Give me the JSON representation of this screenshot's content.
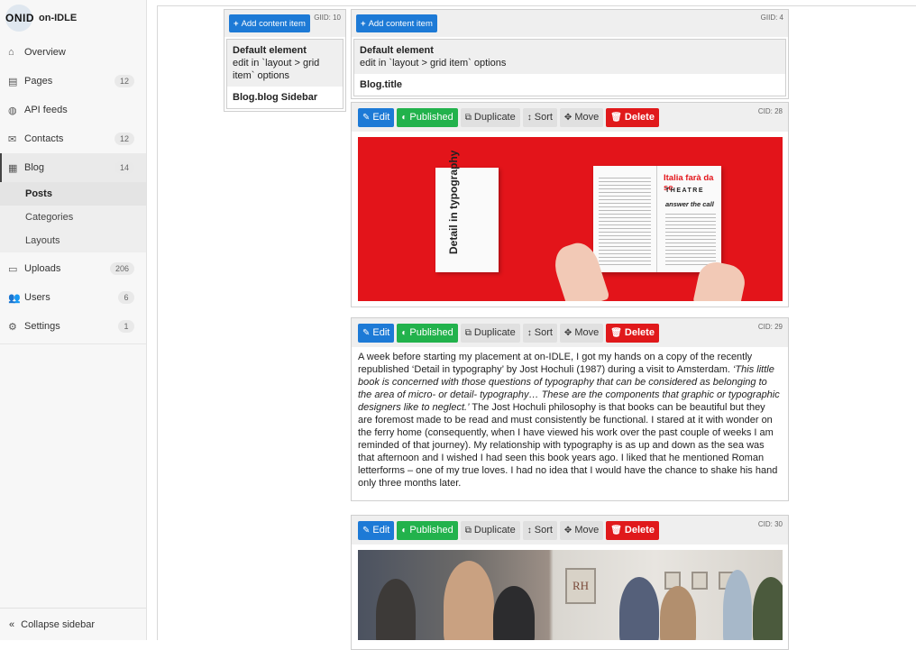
{
  "brand": {
    "logo_text": "ONID",
    "name": "on-IDLE"
  },
  "nav": {
    "overview": "Overview",
    "pages": "Pages",
    "pages_count": "12",
    "api": "API feeds",
    "contacts": "Contacts",
    "contacts_count": "12",
    "blog": "Blog",
    "blog_count": "14",
    "posts": "Posts",
    "categories": "Categories",
    "layouts": "Layouts",
    "uploads": "Uploads",
    "uploads_count": "206",
    "users": "Users",
    "users_count": "6",
    "settings": "Settings",
    "settings_count": "1",
    "collapse": "Collapse sidebar"
  },
  "left_column": {
    "add_label": "Add content item",
    "gid": "GIID: 10",
    "default_title": "Default element",
    "default_desc": "edit in `layout > grid item` options",
    "item_label": "Blog.blog Sidebar"
  },
  "right_column": {
    "add_label": "Add content item",
    "gid": "GIID: 4",
    "default_title": "Default element",
    "default_desc": "edit in `layout > grid item` options",
    "item_label": "Blog.title"
  },
  "toolbar": {
    "edit": "Edit",
    "published": "Published",
    "duplicate": "Duplicate",
    "sort": "Sort",
    "move": "Move",
    "delete": "Delete"
  },
  "cards": {
    "c1": {
      "cid": "CID: 28"
    },
    "c2": {
      "cid": "CID: 29",
      "p1": "A week before starting my placement at on-IDLE, I got my hands on a copy of the recently republished ‘Detail in typography’ by Jost Hochuli (1987) during a visit to Amsterdam. ",
      "quote": "‘This little book is concerned with those questions of typography that can be considered as belonging to the area of micro- or detail- typography… These are the components that graphic or typographic designers like to neglect.’",
      "p2": " The Jost Hochuli philosophy is that books can be beautiful but they are foremost made to be read and must consistently be functional. I stared at it with wonder on the ferry home (consequently, when I have viewed his work over the past couple of weeks I am reminded of that journey). My relationship with typography is as up and down as the sea was that afternoon and I wished I had seen this book years ago. I liked that he mentioned Roman letterforms – one of my true loves. I had no idea that I would have the chance to shake his hand only three months later."
    },
    "c3": {
      "cid": "CID: 30"
    }
  },
  "image1": {
    "book_cover": "Detail in typography",
    "spread_title": "Italia farà da se",
    "spread_sub": "THEATRE",
    "spread_ans": "answer the call"
  },
  "image2": {
    "sign": "RH"
  },
  "colors": {
    "primary": "#1d7ad6",
    "success": "#22b24c",
    "danger": "#e0191b",
    "cover_red": "#e3141a"
  }
}
